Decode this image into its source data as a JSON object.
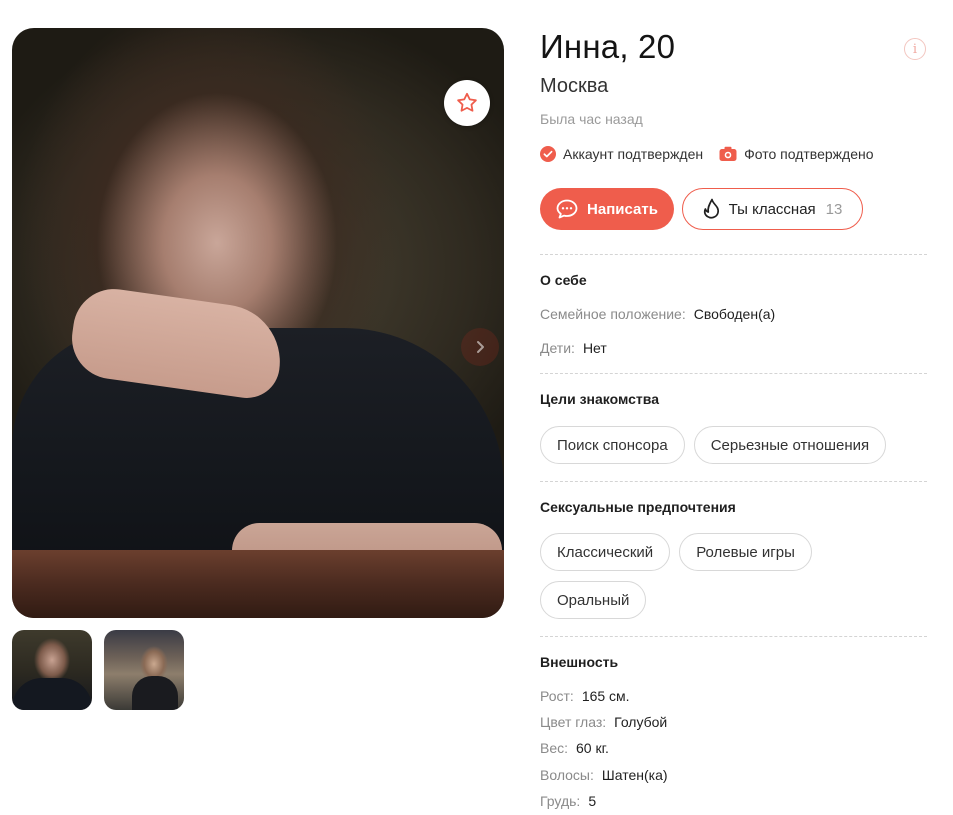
{
  "profile": {
    "name_age": "Инна, 20",
    "city": "Москва",
    "last_seen": "Была час назад"
  },
  "badges": [
    {
      "label": "Аккаунт подтвержден",
      "icon": "check-circle-icon"
    },
    {
      "label": "Фото подтверждено",
      "icon": "camera-icon"
    }
  ],
  "actions": {
    "write_label": "Написать",
    "like_label": "Ты классная",
    "like_count": "13"
  },
  "about": {
    "title": "О себе",
    "rows": [
      {
        "key": "Семейное положение:",
        "value": "Свободен(а)"
      },
      {
        "key": "Дети:",
        "value": "Нет"
      }
    ]
  },
  "goals": {
    "title": "Цели знакомства",
    "tags": [
      "Поиск спонсора",
      "Серьезные отношения"
    ]
  },
  "preferences": {
    "title": "Сексуальные предпочтения",
    "tags": [
      "Классический",
      "Ролевые игры",
      "Оральный"
    ]
  },
  "appearance": {
    "title": "Внешность",
    "rows": [
      {
        "key": "Рост:",
        "value": "165 см."
      },
      {
        "key": "Цвет глаз:",
        "value": "Голубой"
      },
      {
        "key": "Вес:",
        "value": "60 кг."
      },
      {
        "key": "Волосы:",
        "value": "Шатен(ка)"
      },
      {
        "key": "Грудь:",
        "value": "5"
      }
    ]
  },
  "colors": {
    "accent": "#ef5d4c",
    "muted_text": "#9a9a9a",
    "chip_border": "#d8d8d8",
    "verified_green": "#ef5d4c"
  },
  "icons": {
    "favorite": "star-icon",
    "next": "chevron-right-icon",
    "info": "info-icon",
    "write": "chat-bubble-icon",
    "like": "flame-icon"
  }
}
